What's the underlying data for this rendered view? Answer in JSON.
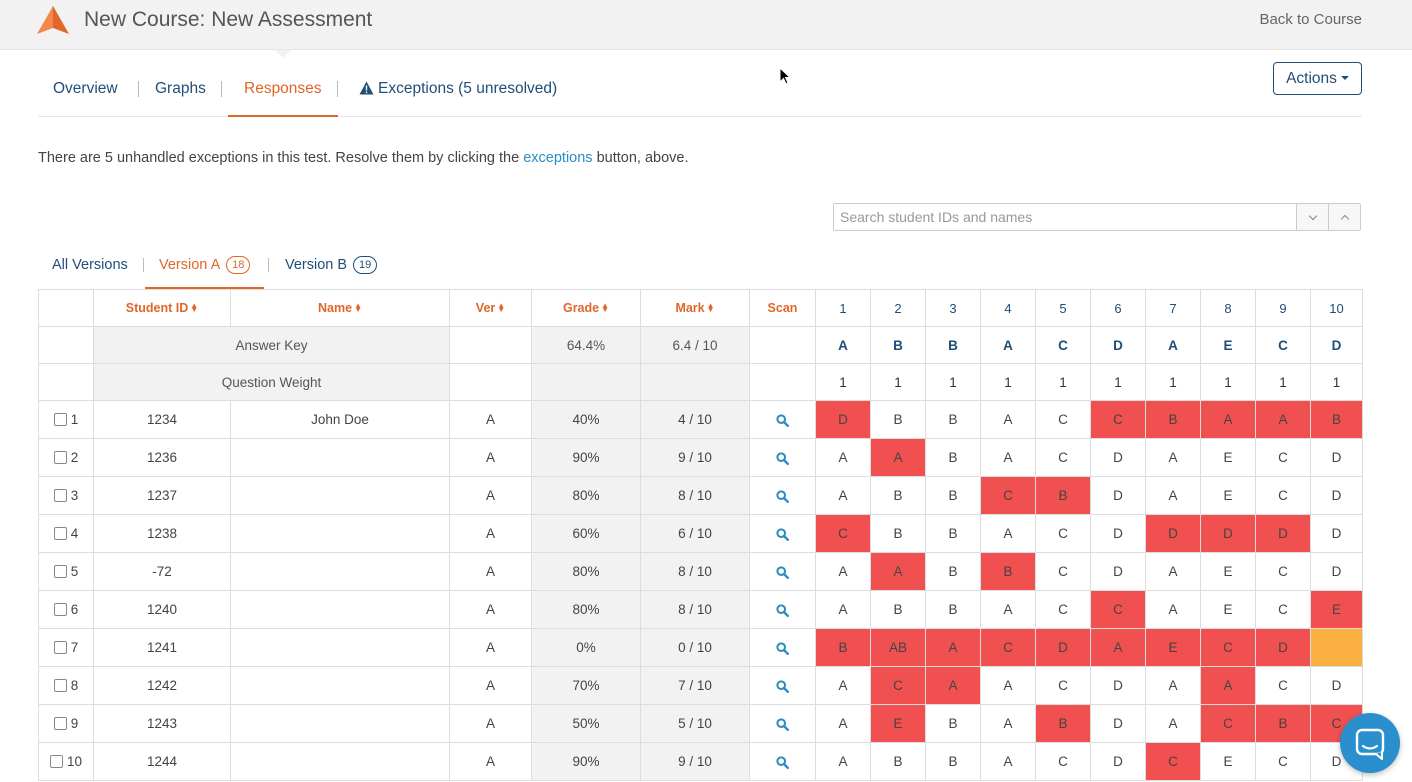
{
  "header": {
    "title": "New Course: New Assessment",
    "back_label": "Back to Course"
  },
  "nav": {
    "tabs": [
      {
        "label": "Overview"
      },
      {
        "label": "Graphs"
      },
      {
        "label": "Responses"
      },
      {
        "label": "Exceptions (5 unresolved)"
      }
    ],
    "active": "Responses",
    "actions_label": "Actions"
  },
  "notice": {
    "prefix": "There are 5 unhandled exceptions in this test. Resolve them by clicking the ",
    "link": "exceptions",
    "suffix": " button, above."
  },
  "search": {
    "placeholder": "Search student IDs and names"
  },
  "versions": {
    "tabs": [
      {
        "label": "All Versions",
        "count": ""
      },
      {
        "label": "Version A",
        "count": "18"
      },
      {
        "label": "Version B",
        "count": "19"
      }
    ],
    "active": "Version A"
  },
  "table": {
    "headers": {
      "student_id": "Student ID",
      "name": "Name",
      "ver": "Ver",
      "grade": "Grade",
      "mark": "Mark",
      "scan": "Scan",
      "questions": [
        "1",
        "2",
        "3",
        "4",
        "5",
        "6",
        "7",
        "8",
        "9",
        "10"
      ]
    },
    "answer_key": {
      "label": "Answer Key",
      "grade": "64.4%",
      "mark": "6.4 / 10",
      "answers": [
        "A",
        "B",
        "B",
        "A",
        "C",
        "D",
        "A",
        "E",
        "C",
        "D"
      ]
    },
    "weights": {
      "label": "Question Weight",
      "values": [
        "1",
        "1",
        "1",
        "1",
        "1",
        "1",
        "1",
        "1",
        "1",
        "1"
      ]
    },
    "rows": [
      {
        "n": "1",
        "id": "1234",
        "name": "John Doe",
        "ver": "A",
        "grade": "40%",
        "mark": "4 / 10",
        "answers": [
          "D",
          "B",
          "B",
          "A",
          "C",
          "C",
          "B",
          "A",
          "A",
          "B"
        ]
      },
      {
        "n": "2",
        "id": "1236",
        "name": "",
        "ver": "A",
        "grade": "90%",
        "mark": "9 / 10",
        "answers": [
          "A",
          "A",
          "B",
          "A",
          "C",
          "D",
          "A",
          "E",
          "C",
          "D"
        ]
      },
      {
        "n": "3",
        "id": "1237",
        "name": "",
        "ver": "A",
        "grade": "80%",
        "mark": "8 / 10",
        "answers": [
          "A",
          "B",
          "B",
          "C",
          "B",
          "D",
          "A",
          "E",
          "C",
          "D"
        ]
      },
      {
        "n": "4",
        "id": "1238",
        "name": "",
        "ver": "A",
        "grade": "60%",
        "mark": "6 / 10",
        "answers": [
          "C",
          "B",
          "B",
          "A",
          "C",
          "D",
          "D",
          "D",
          "D",
          "D"
        ]
      },
      {
        "n": "5",
        "id": "-72",
        "name": "",
        "ver": "A",
        "grade": "80%",
        "mark": "8 / 10",
        "answers": [
          "A",
          "A",
          "B",
          "B",
          "C",
          "D",
          "A",
          "E",
          "C",
          "D"
        ]
      },
      {
        "n": "6",
        "id": "1240",
        "name": "",
        "ver": "A",
        "grade": "80%",
        "mark": "8 / 10",
        "answers": [
          "A",
          "B",
          "B",
          "A",
          "C",
          "C",
          "A",
          "E",
          "C",
          "E"
        ]
      },
      {
        "n": "7",
        "id": "1241",
        "name": "",
        "ver": "A",
        "grade": "0%",
        "mark": "0 / 10",
        "answers": [
          "B",
          "AB",
          "A",
          "C",
          "D",
          "A",
          "E",
          "C",
          "D",
          ""
        ]
      },
      {
        "n": "8",
        "id": "1242",
        "name": "",
        "ver": "A",
        "grade": "70%",
        "mark": "7 / 10",
        "answers": [
          "A",
          "C",
          "A",
          "A",
          "C",
          "D",
          "A",
          "A",
          "C",
          "D"
        ]
      },
      {
        "n": "9",
        "id": "1243",
        "name": "",
        "ver": "A",
        "grade": "50%",
        "mark": "5 / 10",
        "answers": [
          "A",
          "E",
          "B",
          "A",
          "B",
          "D",
          "A",
          "C",
          "B",
          "C"
        ]
      },
      {
        "n": "10",
        "id": "1244",
        "name": "",
        "ver": "A",
        "grade": "90%",
        "mark": "9 / 10",
        "answers": [
          "A",
          "B",
          "B",
          "A",
          "C",
          "D",
          "C",
          "E",
          "C",
          "D"
        ]
      }
    ]
  },
  "colors": {
    "accent": "#e0662a",
    "link": "#1f4e79",
    "wrong": "#f05050",
    "blank": "#f9b040",
    "chat": "#2a8fcd"
  }
}
